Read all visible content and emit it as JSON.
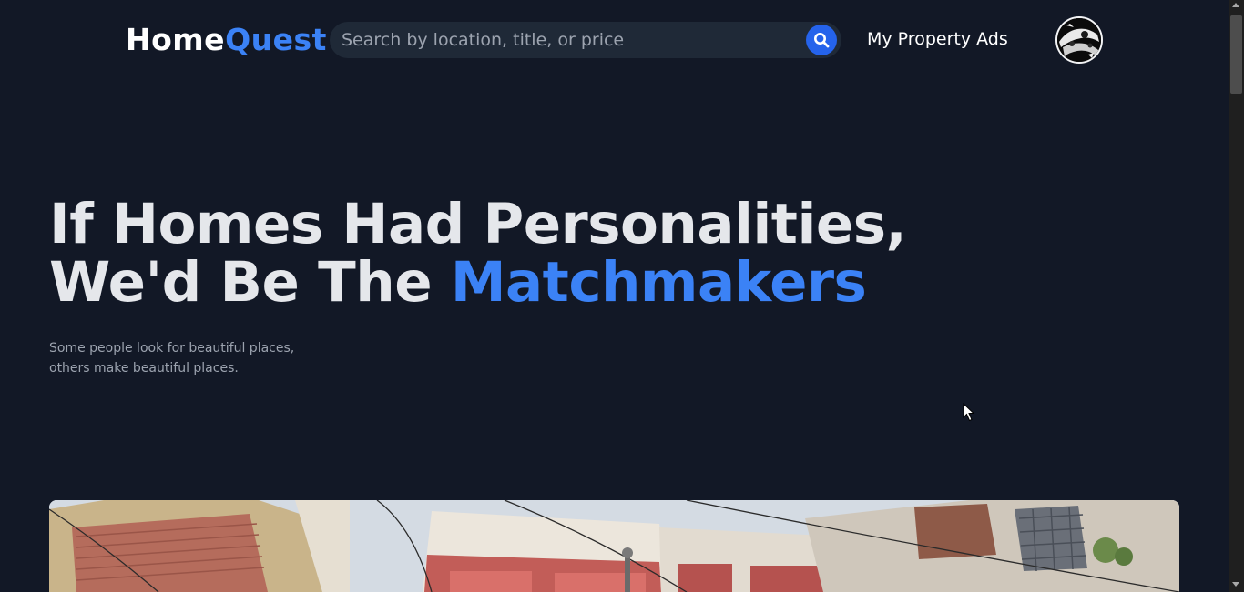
{
  "brand": {
    "part1": "Home",
    "part2": "Quest"
  },
  "search": {
    "placeholder": "Search by location, title, or price",
    "value": "",
    "button_icon": "search-icon"
  },
  "nav": {
    "my_ads": "My Property Ads"
  },
  "avatar": {
    "icon": "avatar-icon"
  },
  "hero": {
    "line1": "If Homes Had Personalities,",
    "line2_prefix": "We'd Be The ",
    "line2_accent": "Matchmakers",
    "sub_line1": "Some people look for beautiful places,",
    "sub_line2": "others make beautiful places."
  },
  "colors": {
    "background": "#121826",
    "accent": "#3b82f6",
    "search_bg": "#1f2937",
    "search_button": "#2563eb"
  }
}
